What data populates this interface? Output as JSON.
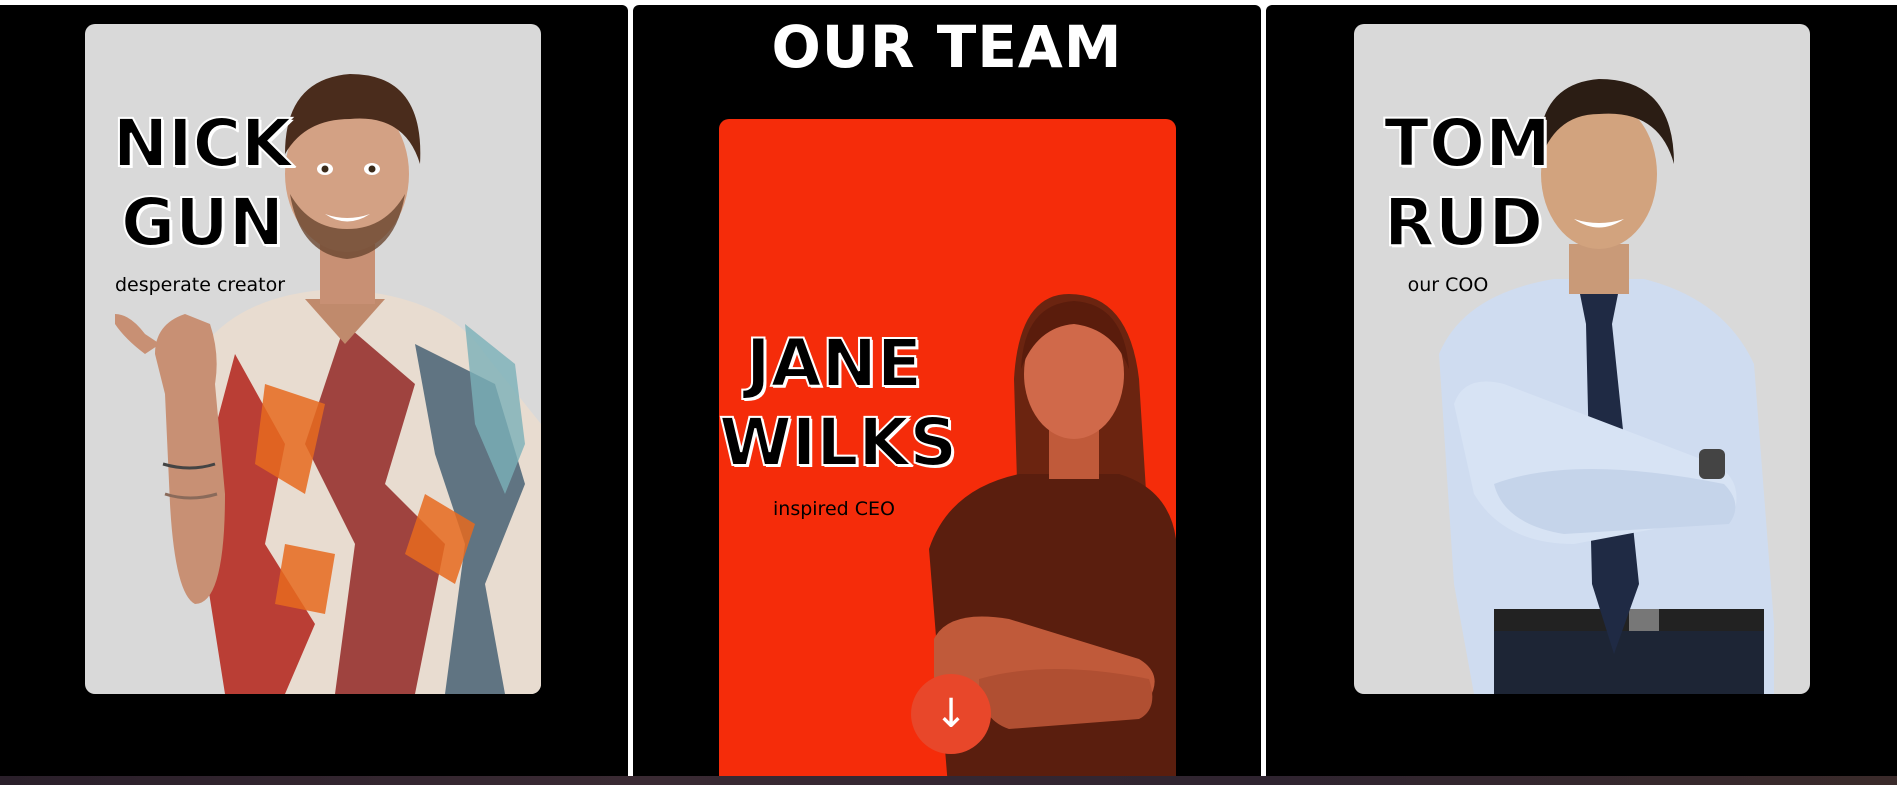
{
  "section": {
    "title": "OUR TEAM"
  },
  "members": [
    {
      "first": "NICK",
      "last": "GUN",
      "role": "desperate creator"
    },
    {
      "first": "JANE",
      "last": "WILKS",
      "role": "inspired CEO"
    },
    {
      "first": "TOM",
      "last": "RUD",
      "role": "our COO"
    }
  ],
  "scroll_button": {
    "glyph": "↓"
  },
  "colors": {
    "background": "#000000",
    "card_grey": "#d9d9d9",
    "card_accent": "#f52c0a",
    "button": "#e8472a"
  }
}
